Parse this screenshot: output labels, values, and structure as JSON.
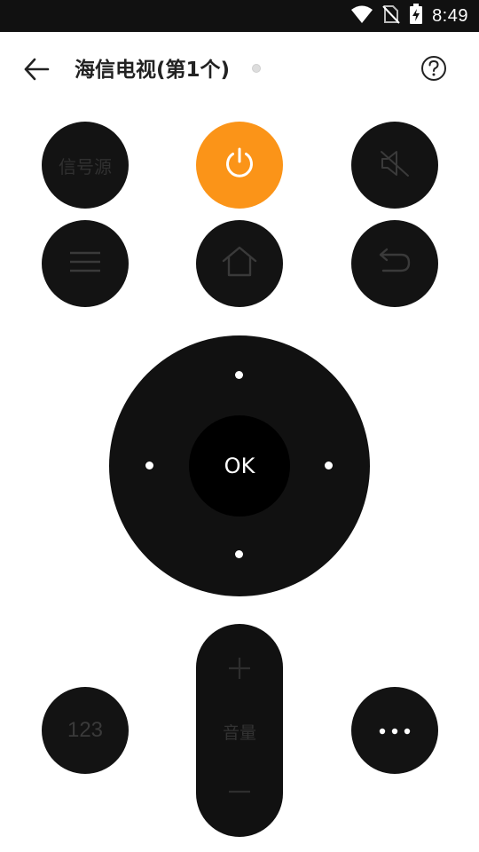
{
  "status_bar": {
    "time": "8:49",
    "icons": [
      "wifi-icon",
      "no-sim-icon",
      "battery-charging-icon"
    ]
  },
  "header": {
    "title": "海信电视(第1个)",
    "back_icon": "arrow-left-icon",
    "help_icon": "question-circle-icon"
  },
  "buttons": {
    "source_label": "信号源",
    "power_icon": "power-icon",
    "mute_icon": "volume-mute-icon",
    "menu_icon": "menu-icon",
    "home_icon": "home-icon",
    "back_icon": "return-icon",
    "numpad_label": "123",
    "more_icon": "more-dots-icon"
  },
  "dpad": {
    "ok_label": "OK"
  },
  "volume": {
    "label": "音量",
    "up_icon": "plus-icon",
    "down_icon": "minus-icon"
  },
  "colors": {
    "accent": "#fb9418",
    "button_bg": "#131313",
    "status_bar_bg": "#111111",
    "background": "#ffffff"
  }
}
